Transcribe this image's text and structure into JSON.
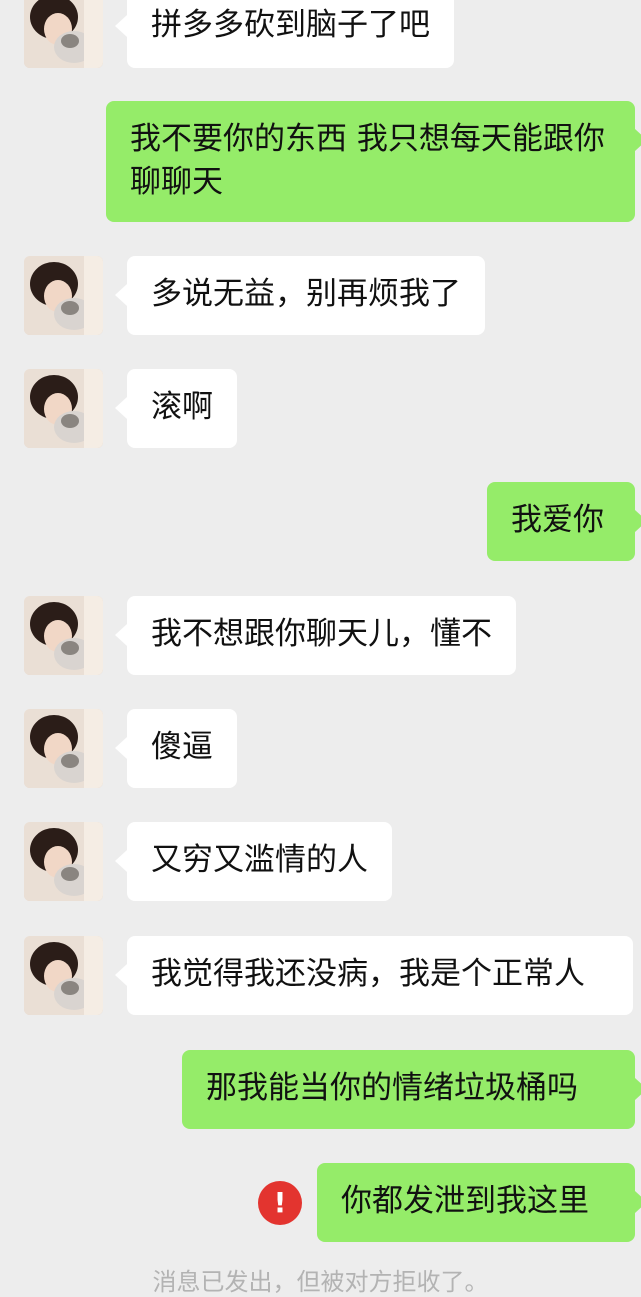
{
  "colors": {
    "background": "#ededed",
    "incoming_bubble": "#ffffff",
    "outgoing_bubble": "#95ec69",
    "error": "#e3342f",
    "system_text": "#b3b3b3"
  },
  "messages": [
    {
      "side": "in",
      "text": "拼多多砍到脑子了吧"
    },
    {
      "side": "out",
      "text": "我不要你的东西 我只想每天能跟你聊聊天"
    },
    {
      "side": "in",
      "text": "多说无益，别再烦我了"
    },
    {
      "side": "in",
      "text": "滚啊"
    },
    {
      "side": "out",
      "text": "我爱你"
    },
    {
      "side": "in",
      "text": "我不想跟你聊天儿，懂不"
    },
    {
      "side": "in",
      "text": "傻逼"
    },
    {
      "side": "in",
      "text": "又穷又滥情的人"
    },
    {
      "side": "in",
      "text": "我觉得我还没病，我是个正常人"
    },
    {
      "side": "out",
      "text": "那我能当你的情绪垃圾桶吗"
    },
    {
      "side": "out",
      "text": "你都发泄到我这里",
      "status": "failed",
      "status_icon": "exclamation-icon",
      "status_symbol": "!"
    }
  ],
  "system_notice": "消息已发出，但被对方拒收了。"
}
